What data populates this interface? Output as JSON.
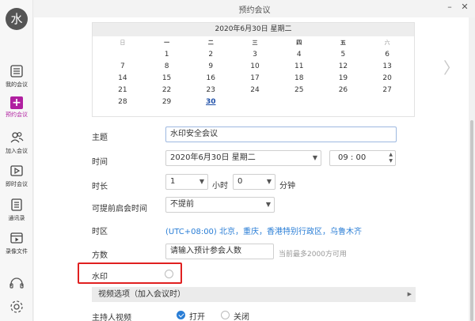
{
  "user": {
    "avatar_text": "水"
  },
  "nav": [
    {
      "label": "我的会议",
      "icon": "list-icon"
    },
    {
      "label": "预约会议",
      "icon": "plus-icon",
      "active": true
    },
    {
      "label": "加入会议",
      "icon": "people-icon"
    },
    {
      "label": "即时会议",
      "icon": "video-icon"
    },
    {
      "label": "通讯录",
      "icon": "contacts-icon"
    },
    {
      "label": "录像文件",
      "icon": "recording-icon"
    }
  ],
  "window": {
    "title": "预约会议"
  },
  "calendar": {
    "header": "2020年6月30日 星期二",
    "weekdays": [
      "日",
      "一",
      "二",
      "三",
      "四",
      "五",
      "六"
    ],
    "days": [
      "1",
      "2",
      "3",
      "4",
      "5",
      "6",
      "7",
      "8",
      "9",
      "10",
      "11",
      "12",
      "13",
      "14",
      "15",
      "16",
      "17",
      "18",
      "19",
      "20",
      "21",
      "22",
      "23",
      "24",
      "25",
      "26",
      "27",
      "28",
      "29",
      "30"
    ],
    "selected_day": "30"
  },
  "form": {
    "subject_label": "主题",
    "subject_value": "水印安全会议",
    "time_label": "时间",
    "date_value": "2020年6月30日 星期二",
    "time_value": "09 : 00",
    "duration_label": "时长",
    "hours_value": "1",
    "hours_unit": "小时",
    "minutes_value": "0",
    "minutes_unit": "分钟",
    "early_label": "可提前启会时间",
    "early_value": "不提前",
    "timezone_label": "时区",
    "timezone_value": "(UTC+08:00) 北京，重庆，香港特别行政区，乌鲁木齐",
    "capacity_label": "方数",
    "capacity_placeholder": "请输入预计参会人数",
    "capacity_hint": "当前最多2000方可用",
    "watermark_label": "水印",
    "section_title": "视频选项（加入会议时）",
    "host_video_label": "主持人视频",
    "host_video_on": "打开",
    "host_video_off": "关闭"
  }
}
